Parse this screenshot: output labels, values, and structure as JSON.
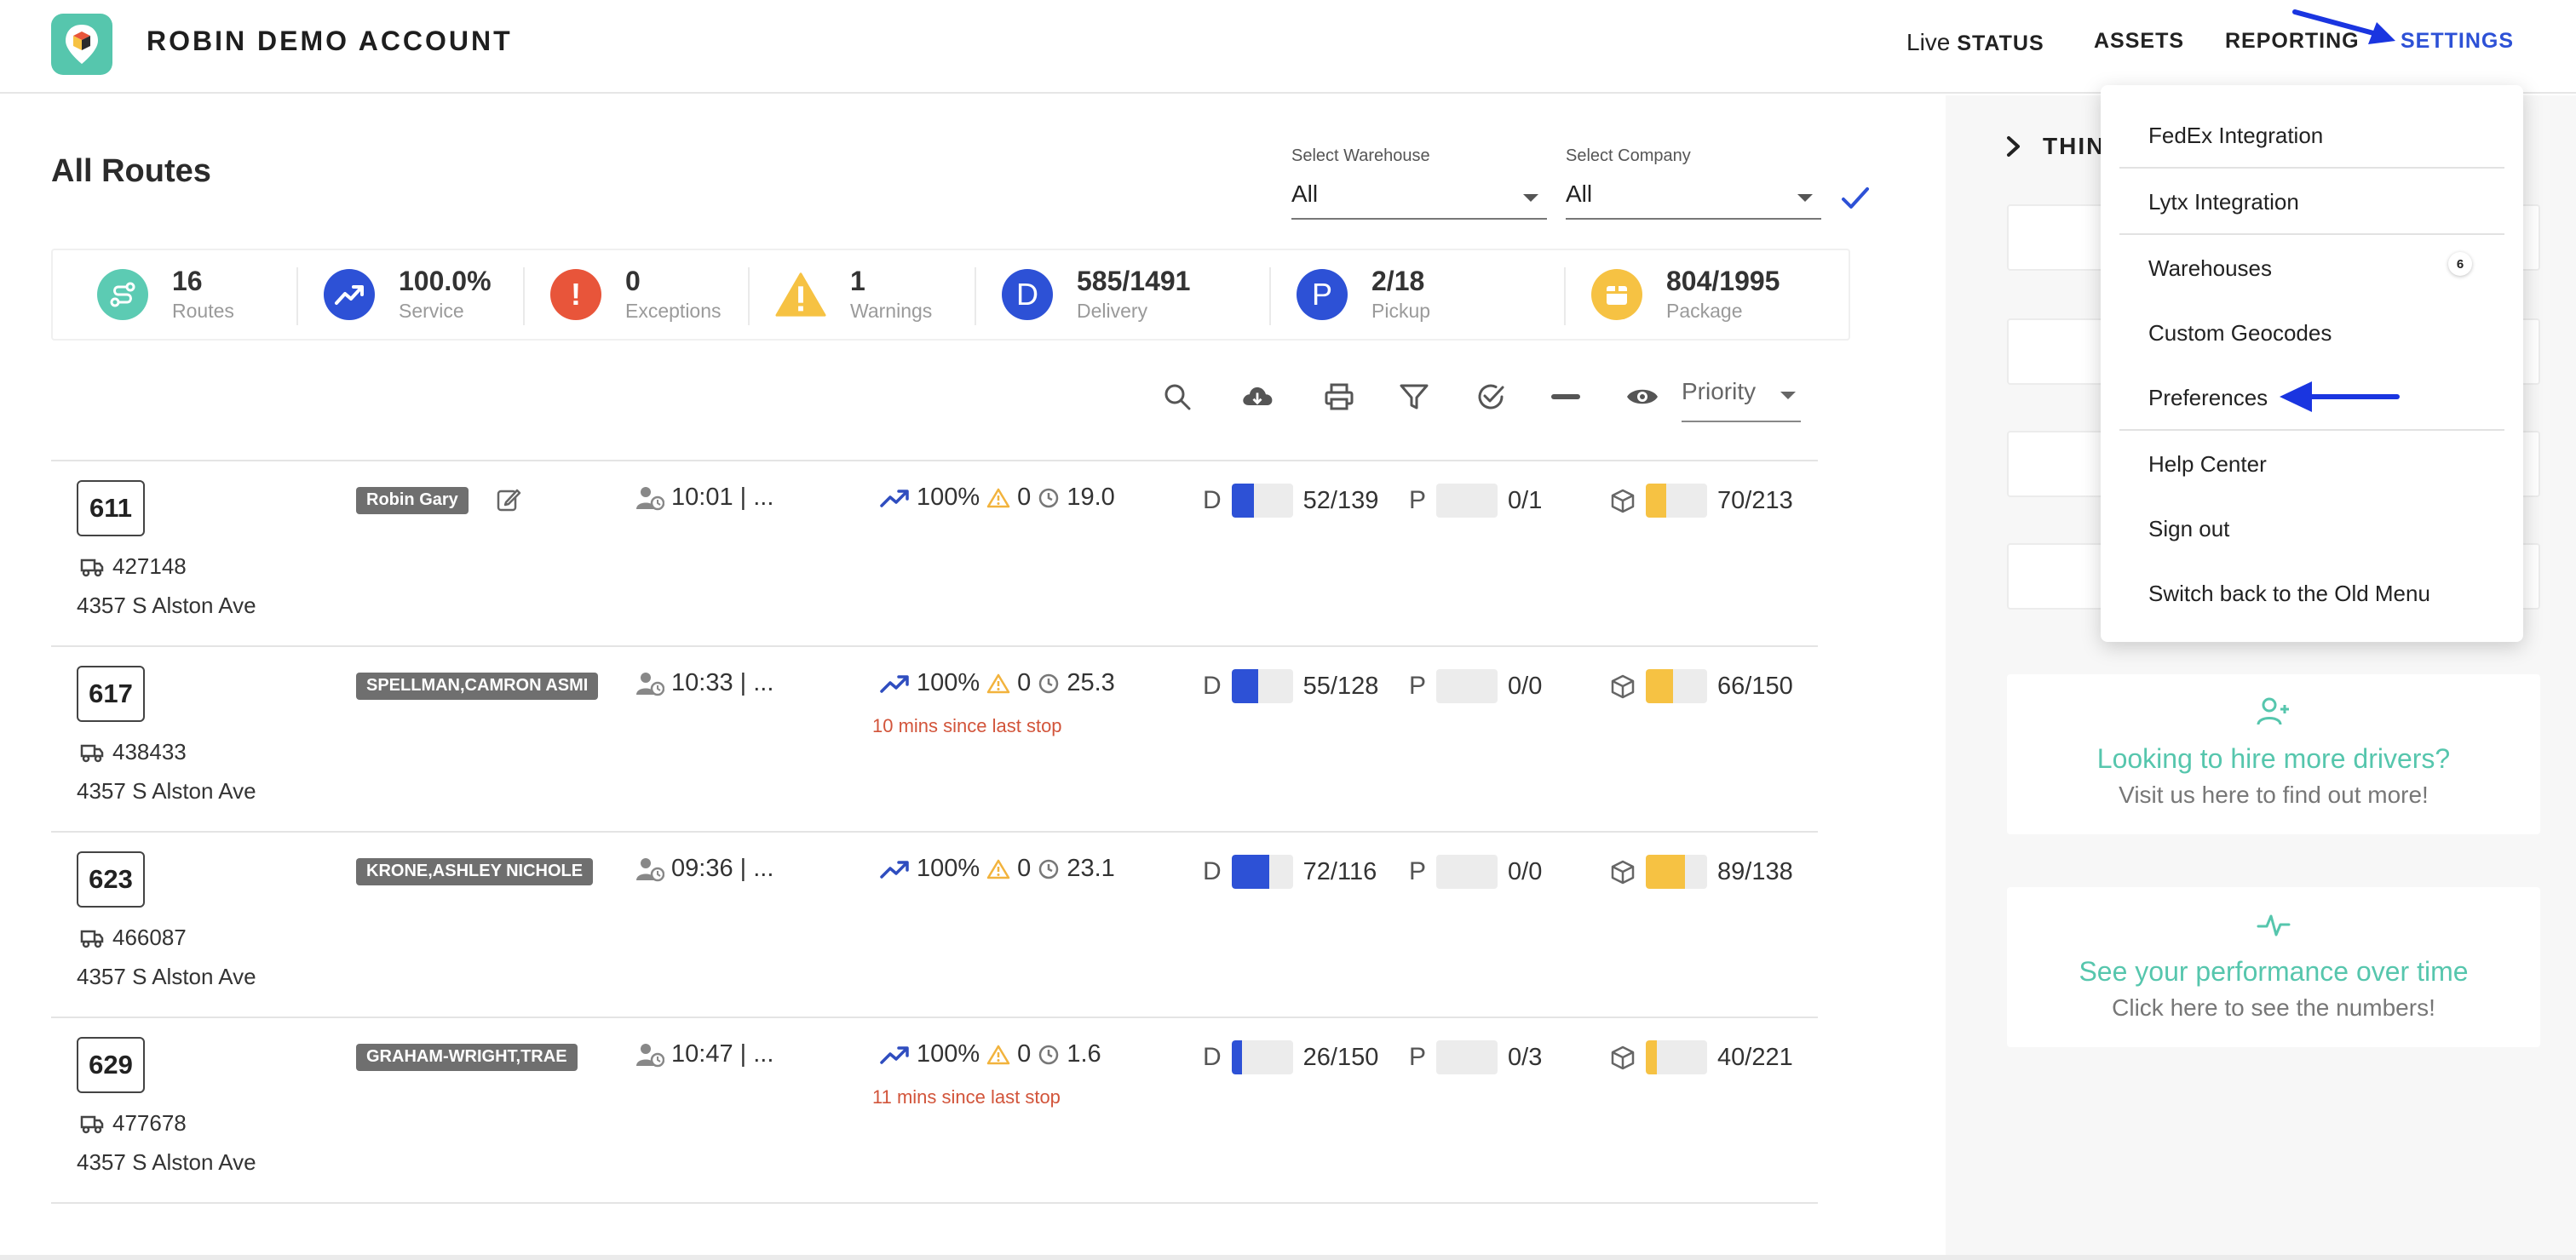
{
  "header": {
    "brand": "ROBIN DEMO ACCOUNT",
    "nav": {
      "live_prefix": "Live",
      "live_status": "STATUS",
      "assets": "ASSETS",
      "reporting": "REPORTING",
      "settings": "SETTINGS"
    }
  },
  "main": {
    "title": "All Routes",
    "filters": {
      "warehouse_label": "Select Warehouse",
      "warehouse_value": "All",
      "company_label": "Select Company",
      "company_value": "All"
    },
    "stats": [
      {
        "value": "16",
        "label": "Routes",
        "icon": "route-icon",
        "color": "#5ccbb3"
      },
      {
        "value": "100.0%",
        "label": "Service",
        "icon": "trending-up-icon",
        "color": "#2d51d6"
      },
      {
        "value": "0",
        "label": "Exceptions",
        "icon": "exclamation-icon",
        "color": "#e8553a"
      },
      {
        "value": "1",
        "label": "Warnings",
        "icon": "warning-icon",
        "color": "#f6c243"
      },
      {
        "value": "585/1491",
        "label": "Delivery",
        "icon": "delivery-d-icon",
        "glyph": "D",
        "color": "#2d51d6"
      },
      {
        "value": "2/18",
        "label": "Pickup",
        "icon": "pickup-p-icon",
        "glyph": "P",
        "color": "#2d51d6"
      },
      {
        "value": "804/1995",
        "label": "Package",
        "icon": "package-icon",
        "color": "#f6c243"
      }
    ],
    "toolbar": {
      "priority": "Priority"
    },
    "routes": [
      {
        "number": "611",
        "vehicle": "427148",
        "address": "4357 S Alston Ave",
        "driver": "Robin Gary",
        "editable": true,
        "time": "10:01 | ...",
        "service": "100%",
        "warnings": "0",
        "duration": "19.0",
        "since": "",
        "delivery_letter": "D",
        "delivery": "52/139",
        "delivery_fill": 0.37,
        "pickup_letter": "P",
        "pickup": "0/1",
        "pickup_fill": 0,
        "package": "70/213",
        "package_fill": 0.33
      },
      {
        "number": "617",
        "vehicle": "438433",
        "address": "4357 S Alston Ave",
        "driver": "SPELLMAN,CAMRON ASMI",
        "editable": false,
        "time": "10:33 | ...",
        "service": "100%",
        "warnings": "0",
        "duration": "25.3",
        "since": "10 mins since last stop",
        "delivery_letter": "D",
        "delivery": "55/128",
        "delivery_fill": 0.43,
        "pickup_letter": "P",
        "pickup": "0/0",
        "pickup_fill": 0,
        "package": "66/150",
        "package_fill": 0.44
      },
      {
        "number": "623",
        "vehicle": "466087",
        "address": "4357 S Alston Ave",
        "driver": "KRONE,ASHLEY NICHOLE",
        "editable": false,
        "time": "09:36 | ...",
        "service": "100%",
        "warnings": "0",
        "duration": "23.1",
        "since": "",
        "delivery_letter": "D",
        "delivery": "72/116",
        "delivery_fill": 0.62,
        "pickup_letter": "P",
        "pickup": "0/0",
        "pickup_fill": 0,
        "package": "89/138",
        "package_fill": 0.64
      },
      {
        "number": "629",
        "vehicle": "477678",
        "address": "4357 S Alston Ave",
        "driver": "GRAHAM-WRIGHT,TRAE",
        "editable": false,
        "time": "10:47 | ...",
        "service": "100%",
        "warnings": "0",
        "duration": "1.6",
        "since": "11 mins since last stop",
        "delivery_letter": "D",
        "delivery": "26/150",
        "delivery_fill": 0.17,
        "pickup_letter": "P",
        "pickup": "0/3",
        "pickup_fill": 0,
        "package": "40/221",
        "package_fill": 0.18
      }
    ]
  },
  "right_panel": {
    "section_title": "THIN",
    "hire": {
      "title": "Looking to hire more drivers?",
      "subtitle": "Visit us here to find out more!"
    },
    "performance": {
      "title": "See your performance over time",
      "subtitle": "Click here to see the numbers!"
    }
  },
  "settings_menu": {
    "items": [
      "FedEx Integration",
      "Lytx Integration",
      "Warehouses",
      "Custom Geocodes",
      "Preferences",
      "Help Center",
      "Sign out",
      "Switch back to the Old Menu"
    ],
    "warehouses_badge": "6"
  },
  "colors": {
    "accent_blue": "#2d51d6",
    "teal": "#56c6ad",
    "warning_yellow": "#f6c243",
    "alert_red": "#d2543a"
  }
}
